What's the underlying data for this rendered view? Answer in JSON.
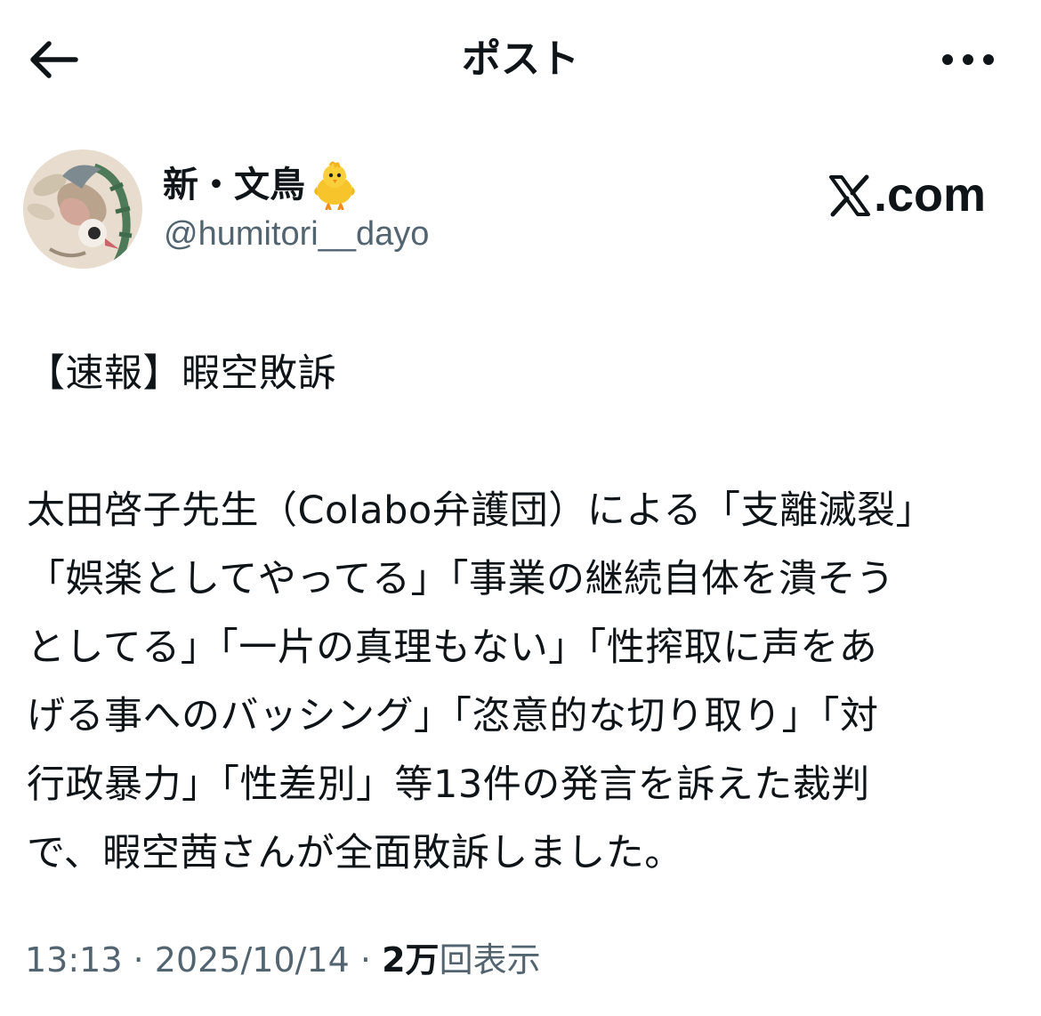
{
  "header": {
    "title": "ポスト",
    "back_icon": "arrow-left-icon",
    "more_icon": "ellipsis-icon"
  },
  "author": {
    "display_name": "新・文鳥",
    "emoji_icon": "baby-chick-icon",
    "handle": "@humitori__dayo"
  },
  "watermark": {
    "text": ".com",
    "logo_icon": "x-logo-icon"
  },
  "post": {
    "lines": [
      "【速報】暇空敗訴",
      "",
      "太田啓子先生（Colabo弁護団）による「支離滅裂」",
      "「娯楽としてやってる」「事業の継続自体を潰そう",
      "としてる」「一片の真理もない」「性搾取に声をあ",
      "げる事へのバッシング」「恣意的な切り取り」「対",
      "行政暴力」「性差別」等13件の発言を訴えた裁判",
      "で、暇空茜さんが全面敗訴しました。"
    ]
  },
  "meta": {
    "time": "13:13",
    "separator": "·",
    "date": "2025/10/14",
    "views_count": "2万",
    "views_label": "回表示"
  },
  "colors": {
    "text": "#0f1419",
    "secondary": "#536471",
    "background": "#ffffff"
  }
}
